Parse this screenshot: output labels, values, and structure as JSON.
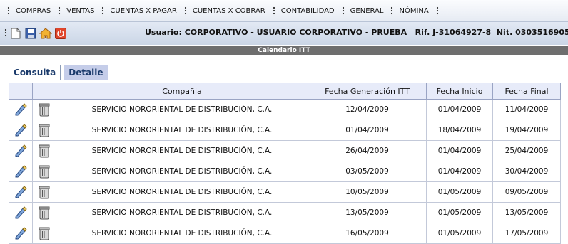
{
  "menu": [
    "COMPRAS",
    "VENTAS",
    "CUENTAS X PAGAR",
    "CUENTAS X COBRAR",
    "CONTABILIDAD",
    "GENERAL",
    "NÓMINA"
  ],
  "toolbar": {
    "user_text": "Usuario: CORPORATIVO - USUARIO CORPORATIVO - PRUEBA   Rif. J-31064927-8  Nit. 0303516905"
  },
  "title": "Calendario ITT",
  "tabs": [
    "Consulta",
    "Detalle"
  ],
  "table": {
    "headers": [
      "",
      "",
      "Compañia",
      "Fecha Generación ITT",
      "Fecha Inicio",
      "Fecha Final"
    ],
    "rows": [
      {
        "company": "SERVICIO NORORIENTAL DE DISTRIBUCIÓN, C.A.",
        "gen": "12/04/2009",
        "start": "01/04/2009",
        "end": "11/04/2009"
      },
      {
        "company": "SERVICIO NORORIENTAL DE DISTRIBUCIÓN, C.A.",
        "gen": "01/04/2009",
        "start": "18/04/2009",
        "end": "19/04/2009"
      },
      {
        "company": "SERVICIO NORORIENTAL DE DISTRIBUCIÓN, C.A.",
        "gen": "26/04/2009",
        "start": "01/04/2009",
        "end": "25/04/2009"
      },
      {
        "company": "SERVICIO NORORIENTAL DE DISTRIBUCIÓN, C.A.",
        "gen": "03/05/2009",
        "start": "01/04/2009",
        "end": "30/04/2009"
      },
      {
        "company": "SERVICIO NORORIENTAL DE DISTRIBUCIÓN, C.A.",
        "gen": "10/05/2009",
        "start": "01/05/2009",
        "end": "09/05/2009"
      },
      {
        "company": "SERVICIO NORORIENTAL DE DISTRIBUCIÓN, C.A.",
        "gen": "13/05/2009",
        "start": "01/05/2009",
        "end": "13/05/2009"
      },
      {
        "company": "SERVICIO NORORIENTAL DE DISTRIBUCIÓN, C.A.",
        "gen": "16/05/2009",
        "start": "01/05/2009",
        "end": "17/05/2009"
      }
    ]
  },
  "icons": {
    "new": "new-document-icon",
    "save": "save-icon",
    "home": "home-icon",
    "exit": "power-icon",
    "edit": "edit-pencil-icon",
    "delete": "trash-icon"
  }
}
